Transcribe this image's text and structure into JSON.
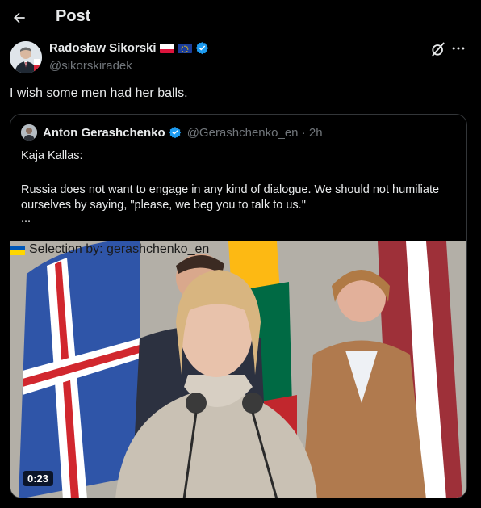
{
  "header": {
    "back_icon": "arrow-left-icon",
    "title": "Post"
  },
  "post": {
    "author_name": "Radosław Sikorski",
    "author_handle": "@sikorskiradek",
    "flags": [
      "poland-flag-icon",
      "eu-flag-icon"
    ],
    "text": "I wish some men had her balls."
  },
  "quote": {
    "author_name": "Anton Gerashchenko",
    "author_handle": "@Gerashchenko_en · 2h",
    "line1": "Kaja Kallas:",
    "line2": "Russia does not want to engage in any kind of dialogue. We should not humiliate ourselves by saying, \"please, we beg you to talk to us.\"",
    "ellipsis": "...",
    "media": {
      "caption": "Selection by: gerashchenko_en",
      "duration": "0:23"
    }
  },
  "colors": {
    "background": "#000000",
    "text": "#e7e9ea",
    "muted": "#71767b",
    "verified": "#1d9bf0",
    "border": "#333639"
  }
}
